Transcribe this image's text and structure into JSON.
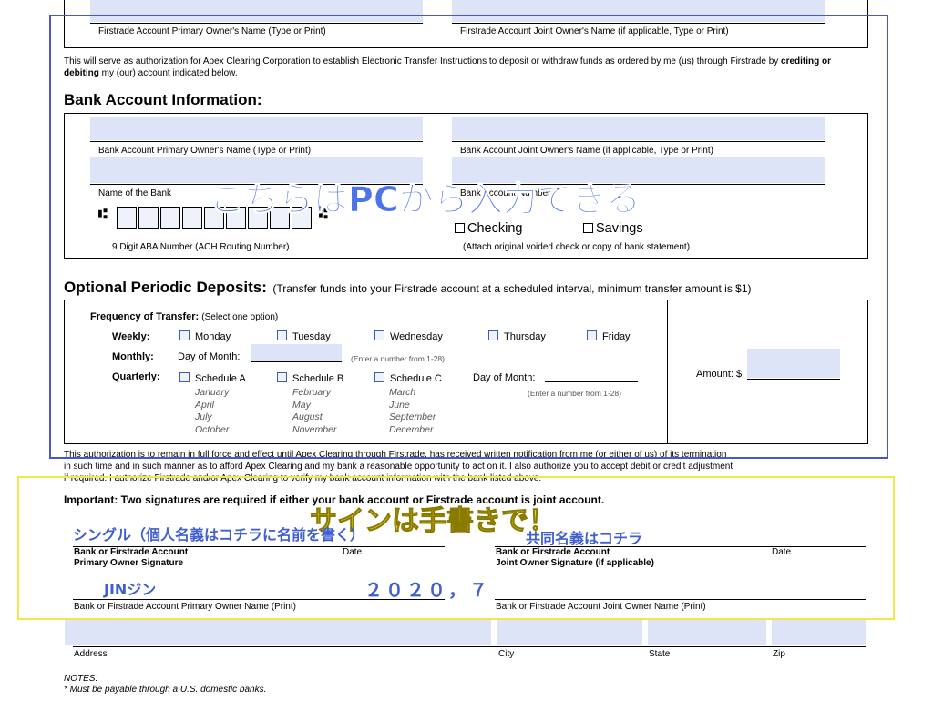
{
  "top_section": {
    "primary_owner_label": "Firstrade Account Primary Owner's Name (Type or Print)",
    "joint_owner_label": "Firstrade Account Joint Owner's Name (if applicable, Type or Print)",
    "authorization_pre": "This will serve as authorization for Apex Clearing Corporation to establish Electronic Transfer Instructions to deposit or withdraw funds as ordered by me (us) through Firstrade by ",
    "authorization_bold": "crediting or debiting",
    "authorization_post": " my (our) account indicated below."
  },
  "bank": {
    "heading": "Bank Account Information:",
    "primary_owner_label": "Bank Account Primary Owner's Name (Type or Print)",
    "joint_owner_label": "Bank Account Joint Owner's Name  (if applicable, Type or Print)",
    "bank_name_label": "Name of the Bank",
    "account_number_label": "Bank Account Number",
    "aba_label": "9 Digit ABA Number (ACH Routing Number)",
    "checking_label": "Checking",
    "savings_label": "Savings",
    "attach_note": "(Attach original voided check or copy of bank statement)"
  },
  "periodic": {
    "heading": "Optional Periodic Deposits:",
    "subheading": "(Transfer funds into your Firstrade account at a scheduled interval, minimum transfer amount is $1)",
    "frequency_label": "Frequency of Transfer:",
    "frequency_note": "(Select one option)",
    "weekly_label": "Weekly:",
    "days": [
      "Monday",
      "Tuesday",
      "Wednesday",
      "Thursday",
      "Friday"
    ],
    "monthly_label": "Monthly:",
    "day_of_month_label": "Day of Month:",
    "range_note": "(Enter a number from 1-28)",
    "quarterly_label": "Quarterly:",
    "schedules": [
      {
        "label": "Schedule A",
        "months": [
          "January",
          "April",
          "July",
          "October"
        ]
      },
      {
        "label": "Schedule B",
        "months": [
          "February",
          "May",
          "August",
          "November"
        ]
      },
      {
        "label": "Schedule C",
        "months": [
          "March",
          "June",
          "September",
          "December"
        ]
      }
    ],
    "amount_label": "Amount: $"
  },
  "authorization": {
    "line1": "This authorization is to remain in full force and effect until Apex Clearing through Firstrade, has received written notification from me (or either of us) of its termination",
    "line2": "in such time and in such manner as to afford Apex Clearing and my bank a reasonable opportunity to act on it. I also authorize you to accept debit or credit adjustment",
    "line3": "if required. I authorize Firstrade and/or Apex Clearing to verify my bank account information with the bank listed above."
  },
  "signatures": {
    "important": "Important:  Two signatures are required if either your bank account or Firstrade account is joint account.",
    "primary_sig_line1": "Bank or Firstrade Account",
    "primary_sig_line2": "Primary Owner Signature",
    "date_label": "Date",
    "joint_sig_line1": "Bank or Firstrade Account",
    "joint_sig_line2": "Joint Owner Signature (if applicable)",
    "primary_name_label": "Bank or Firstrade Account Primary Owner Name (Print)",
    "joint_name_label": "Bank or Firstrade Account Joint Owner Name (Print)"
  },
  "address": {
    "address_label": "Address",
    "city_label": "City",
    "state_label": "State",
    "zip_label": "Zip"
  },
  "notes": {
    "heading": "NOTES:",
    "line1": "* Must be payable through a U.S. domestic banks."
  },
  "annotations": {
    "pc_input": "こちらはPCから入力できる",
    "handwrite": "サインは手書きで！",
    "single": "シングル（個人名義はコチラに名前を書く）",
    "joint": "共同名義はコチラ",
    "name_example": "JINジン",
    "date_example": "２０２０，７",
    "blue_color": "#3f5fd0",
    "yellow_color": "#f2e84a"
  }
}
